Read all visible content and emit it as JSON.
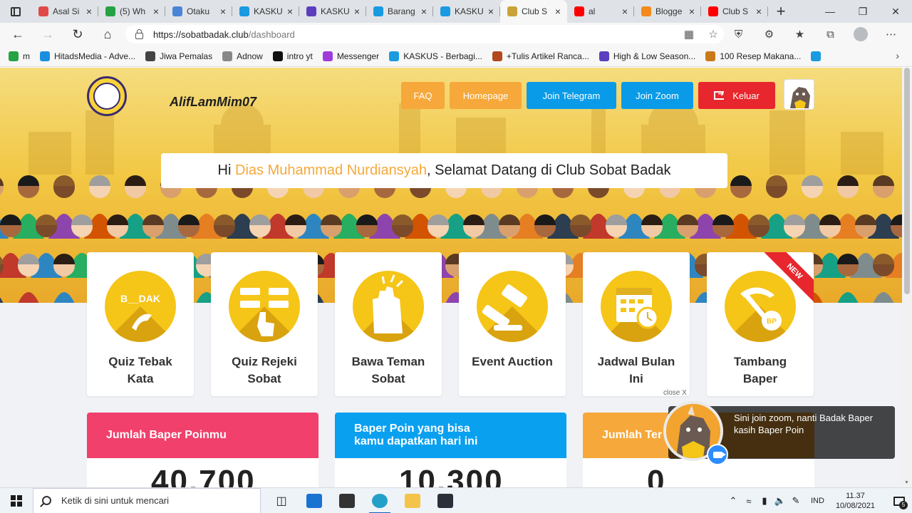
{
  "browser": {
    "tabs": [
      {
        "title": "Asal Si",
        "favicon_color": "#e04848",
        "favicon": "dot-icon"
      },
      {
        "title": "(5) Wh",
        "favicon_color": "#25a244",
        "favicon": "whatsapp-icon"
      },
      {
        "title": "Otaku",
        "favicon_color": "#4a84d6",
        "favicon": "page-icon"
      },
      {
        "title": "KASKU",
        "favicon_color": "#1a9ae0",
        "favicon": "kaskus-icon"
      },
      {
        "title": "KASKU",
        "favicon_color": "#5b3fbf",
        "favicon": "form-icon"
      },
      {
        "title": "Barang",
        "favicon_color": "#1a9ae0",
        "favicon": "kaskus-icon"
      },
      {
        "title": "KASKU",
        "favicon_color": "#1a9ae0",
        "favicon": "kaskus-icon"
      },
      {
        "title": "Club S",
        "favicon_color": "#c9a23a",
        "favicon": "club-icon",
        "active": true
      },
      {
        "title": "al",
        "favicon_color": "#ff0000",
        "favicon": "youtube-icon"
      },
      {
        "title": "Blogge",
        "favicon_color": "#f28a1d",
        "favicon": "blogger-icon"
      },
      {
        "title": "Club S",
        "favicon_color": "#ff0000",
        "favicon": "youtube-icon"
      }
    ],
    "new_tab": "+",
    "url_host": "https://sobatbadak.club",
    "url_path": "/dashboard",
    "bookmarks": [
      {
        "label": "m",
        "color": "#25a244",
        "icon": "s-icon"
      },
      {
        "label": "HitadsMedia - Adve...",
        "color": "#1a8fe0",
        "icon": "hitads-icon"
      },
      {
        "label": "Jiwa Pemalas",
        "color": "#444444",
        "icon": "gamepad-icon"
      },
      {
        "label": "Adnow",
        "color": "#888888",
        "icon": "page-icon"
      },
      {
        "label": "intro yt",
        "color": "#111111",
        "icon": "disc-icon"
      },
      {
        "label": "Messenger",
        "color": "#a03bdb",
        "icon": "messenger-icon"
      },
      {
        "label": "KASKUS - Berbagi...",
        "color": "#1a9ae0",
        "icon": "kaskus-icon"
      },
      {
        "label": "+Tulis Artikel Ranca...",
        "color": "#b3471e",
        "icon": "article-icon"
      },
      {
        "label": "High & Low Season...",
        "color": "#5b3fbf",
        "icon": "season-icon"
      },
      {
        "label": "100 Resep Makana...",
        "color": "#c87a1a",
        "icon": "recipe-icon"
      },
      {
        "label": "",
        "color": "#1a9ae0",
        "icon": "kaskus-icon"
      }
    ]
  },
  "site": {
    "username": "AlifLamMim07",
    "nav": {
      "faq": "FAQ",
      "homepage": "Homepage",
      "telegram": "Join Telegram",
      "zoom": "Join Zoom",
      "logout": "Keluar"
    },
    "welcome_prefix": "Hi ",
    "welcome_name": "Dias Muhammad Nurdiansyah",
    "welcome_suffix": ", Selamat Datang di Club Sobat Badak",
    "cards": [
      {
        "line1": "Quiz Tebak",
        "line2": "Kata",
        "icon": "word-quiz-icon"
      },
      {
        "line1": "Quiz Rejeki",
        "line2": "Sobat",
        "icon": "choice-quiz-icon"
      },
      {
        "line1": "Bawa Teman",
        "line2": "Sobat",
        "icon": "high-five-icon"
      },
      {
        "line1": "Event Auction",
        "line2": "",
        "icon": "gavel-icon"
      },
      {
        "line1": "Jadwal Bulan",
        "line2": "Ini",
        "icon": "calendar-icon"
      },
      {
        "line1": "Tambang",
        "line2": "Baper",
        "icon": "pickaxe-icon",
        "badge": "NEW"
      }
    ],
    "card_bawa_word": "B__DAK",
    "stats": [
      {
        "title_line1": "Jumlah Baper Poinmu",
        "title_line2": "",
        "value": "40.700",
        "color": "#f0406b"
      },
      {
        "title_line1": "Baper Poin yang bisa",
        "title_line2": "kamu dapatkan hari ini",
        "value": "10.300",
        "color": "#0aa0f0"
      },
      {
        "title_line1": "Jumlah Ter",
        "title_line2": "",
        "value": "0",
        "color": "#f6a83a"
      }
    ],
    "popup": {
      "close_label": "close X",
      "message": "Sini join zoom, nanti Badak Baper kasih Baper Poin"
    }
  },
  "taskbar": {
    "search_placeholder": "Ketik di sini untuk mencari",
    "lang": "IND",
    "time": "11.37",
    "date": "10/08/2021",
    "notifications": "5"
  }
}
